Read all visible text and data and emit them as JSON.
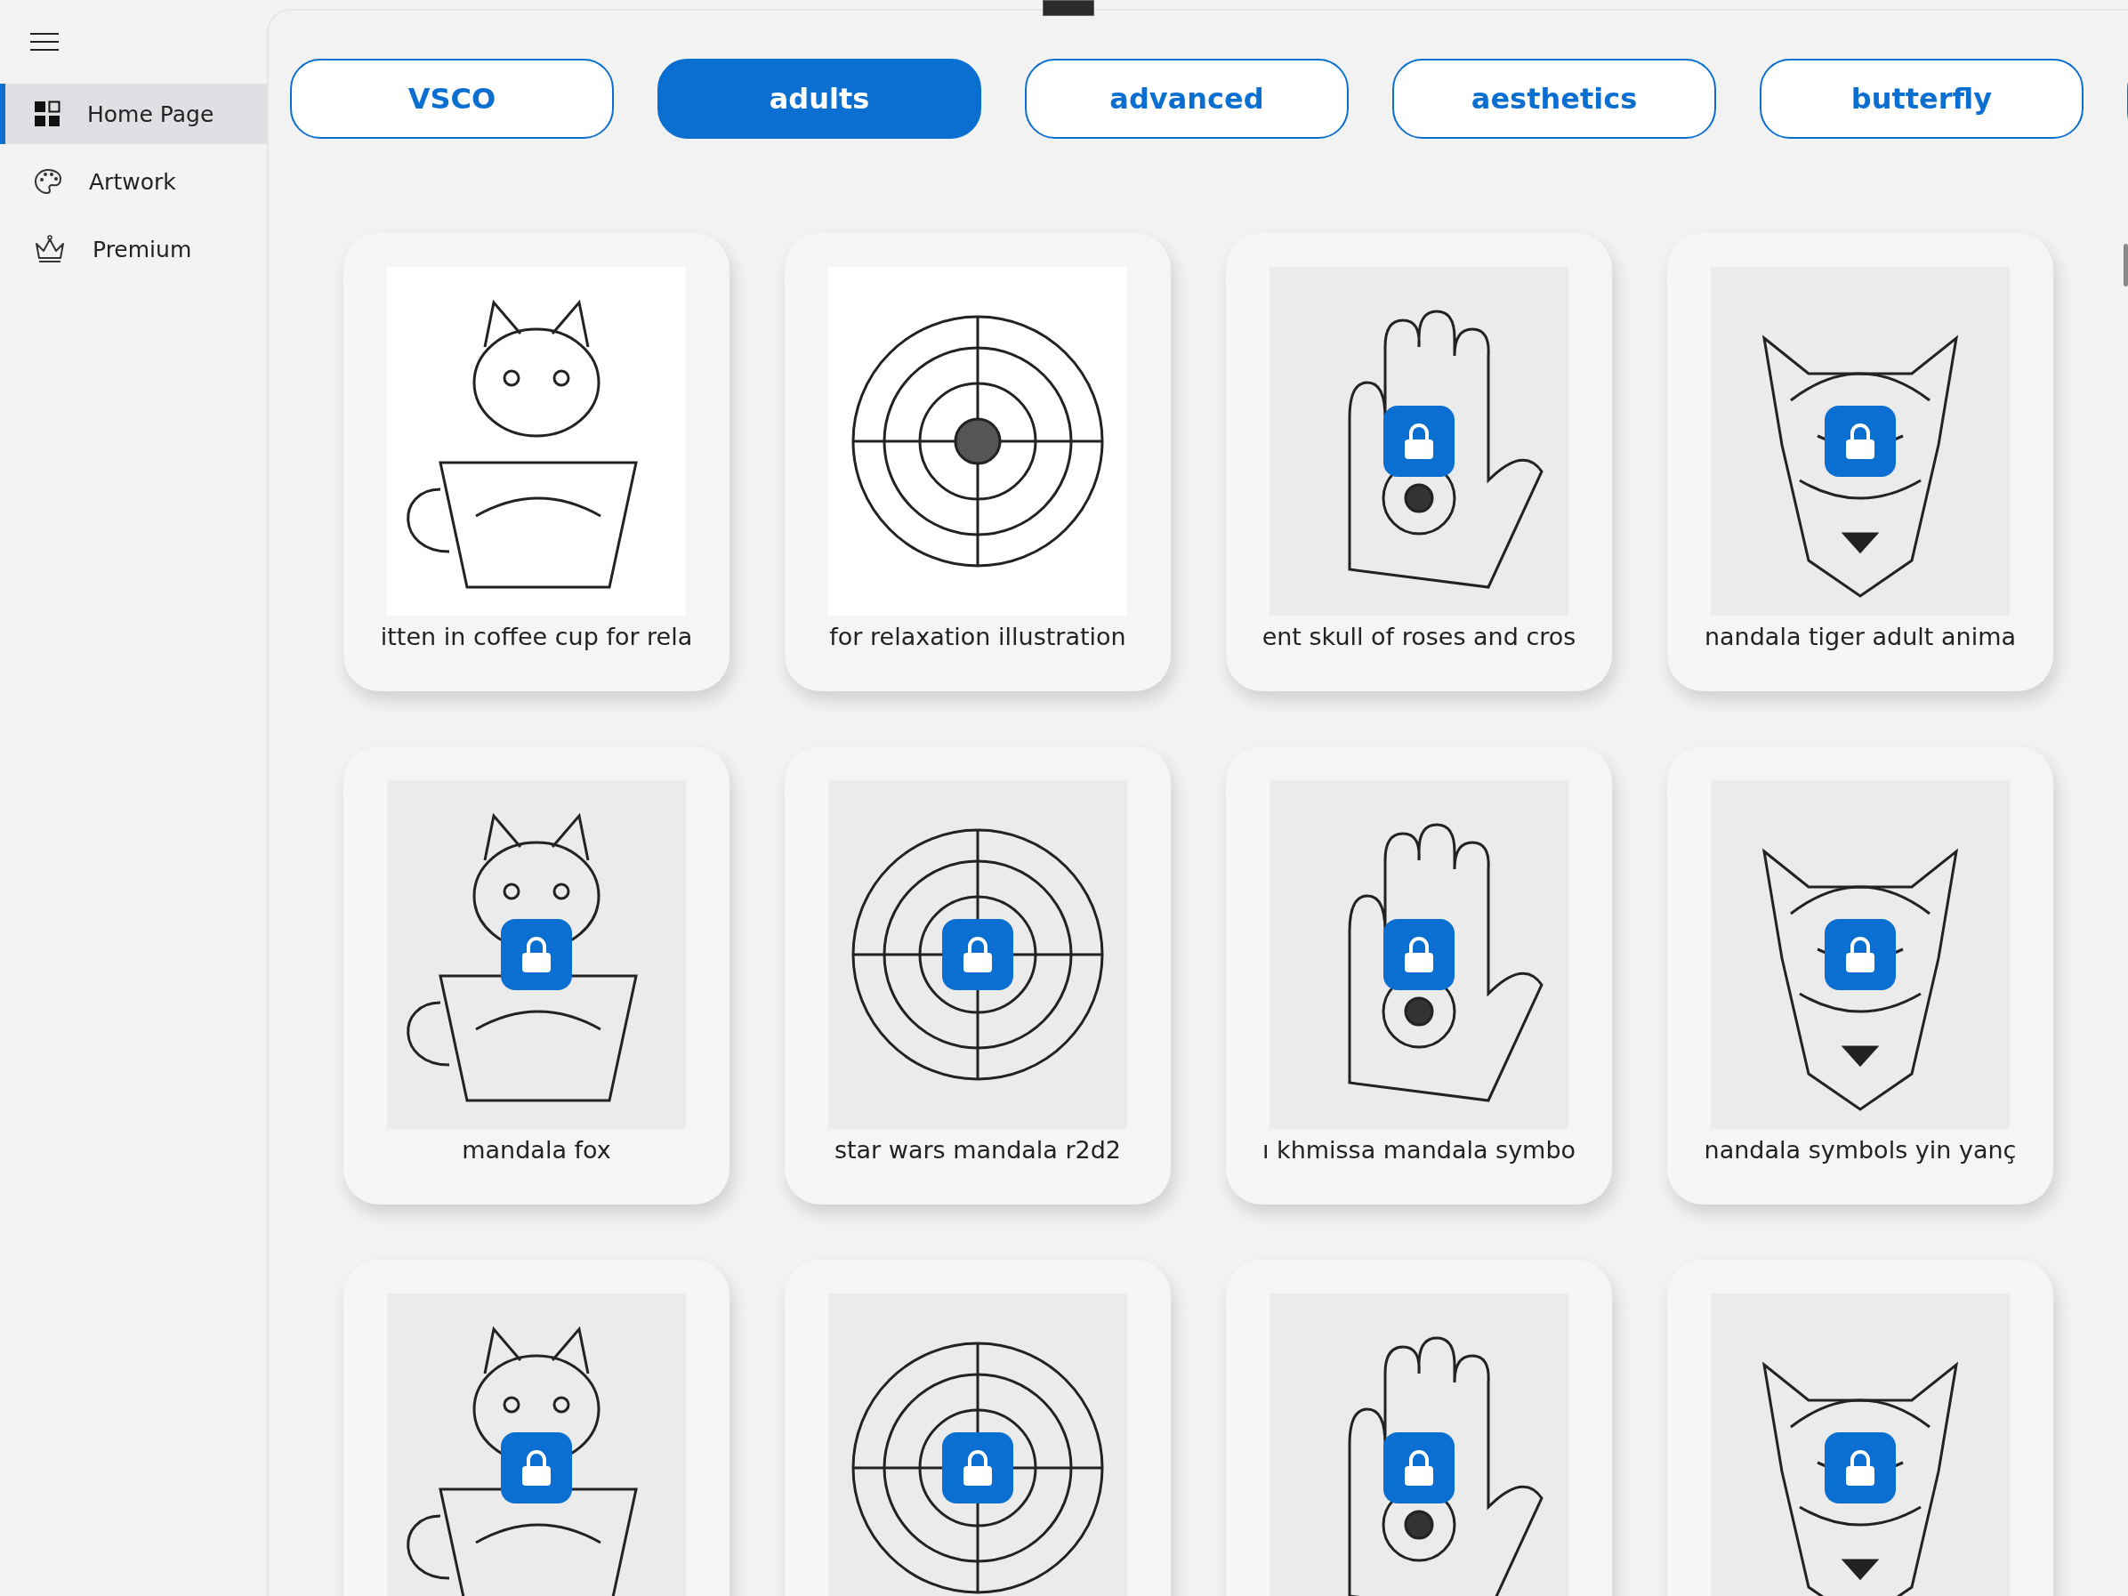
{
  "sidebar": {
    "items": [
      {
        "label": "Home Page",
        "kind": "home",
        "selected": true
      },
      {
        "label": "Artwork",
        "kind": "palette",
        "selected": false
      },
      {
        "label": "Premium",
        "kind": "crown",
        "selected": false
      }
    ]
  },
  "categories": [
    {
      "label": "VSCO",
      "selected": false
    },
    {
      "label": "adults",
      "selected": true
    },
    {
      "label": "advanced",
      "selected": false
    },
    {
      "label": "aesthetics",
      "selected": false
    },
    {
      "label": "butterfly",
      "selected": false
    }
  ],
  "cards": [
    {
      "caption": "itten in coffee cup for rela",
      "locked": false
    },
    {
      "caption": "for relaxation illustration",
      "locked": false
    },
    {
      "caption": "ent skull of roses and cros",
      "locked": true
    },
    {
      "caption": "nandala tiger adult anima",
      "locked": true
    },
    {
      "caption": "mandala fox",
      "locked": true
    },
    {
      "caption": "star wars mandala r2d2",
      "locked": true
    },
    {
      "caption": "ı khmissa mandala symbo",
      "locked": true
    },
    {
      "caption": "nandala symbols yin yanç",
      "locked": true
    },
    {
      "locked": true
    },
    {
      "locked": true
    },
    {
      "locked": true
    },
    {
      "locked": true
    }
  ]
}
